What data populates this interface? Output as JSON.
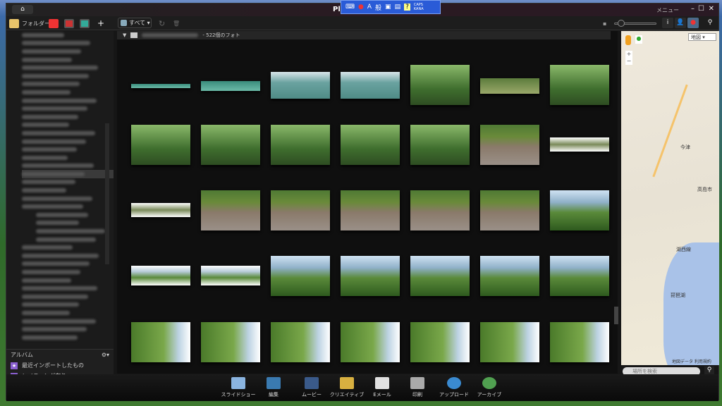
{
  "window": {
    "title": "Pl",
    "menu": "メニュー",
    "minimize": "–",
    "maximize": "☐",
    "close": "✕"
  },
  "ime": {
    "mode": "A",
    "kanji": "般",
    "help": "?",
    "caps": "CAPS",
    "kana": "KANA"
  },
  "tabs": {
    "folder": "フォルダー",
    "add": "+"
  },
  "toolbar": {
    "filter": "すべて ▾",
    "search_icon": "search-icon"
  },
  "folder": {
    "count_label": "- 522個のフォト"
  },
  "albums": {
    "header": "アルバム",
    "items": [
      "最近インポートしたもの",
      "レイティング有り"
    ]
  },
  "map": {
    "type_select": "地図 ▾",
    "search_placeholder": "場所を検索",
    "attribution": "地図データ 利用規約",
    "labels": [
      "高島市",
      "琵琶湖",
      "湖西線",
      "今津"
    ]
  },
  "bottom_buttons": [
    "スライドショー",
    "編集",
    "ムービー",
    "クリエイティブ",
    "Eメール",
    "印刷",
    "アップロード",
    "アーカイブ"
  ],
  "colors": {
    "ime": "#2a5bd7",
    "album_star": "#8a5fd0"
  }
}
